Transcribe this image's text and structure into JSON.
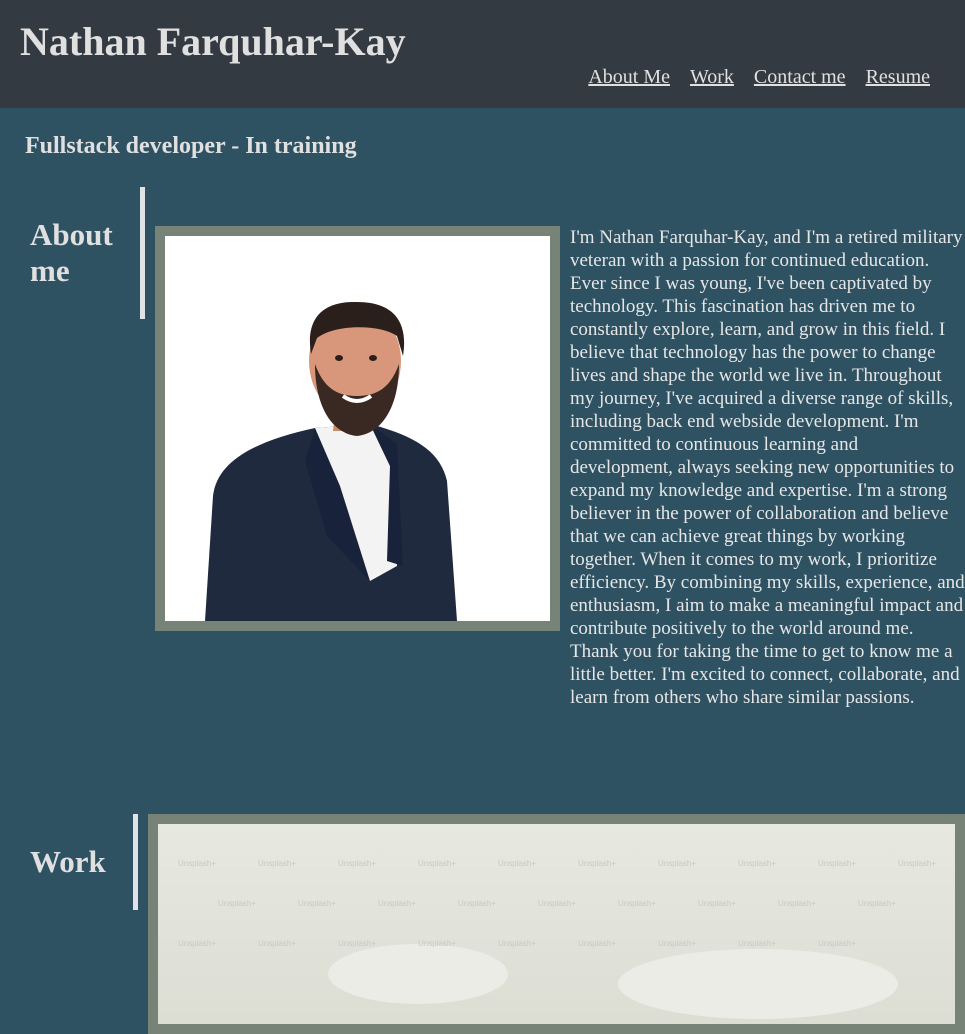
{
  "header": {
    "site_title": "Nathan Farquhar-Kay",
    "nav": [
      {
        "label": "About Me"
      },
      {
        "label": "Work"
      },
      {
        "label": "Contact me"
      },
      {
        "label": "Resume"
      }
    ]
  },
  "tagline": "Fullstack developer - In training",
  "about": {
    "heading": "About me",
    "photo_alt": "Portrait of Nathan Farquhar-Kay",
    "text": "I'm Nathan Farquhar-Kay, and I'm a retired military veteran with a passion for continued education. Ever since I was young, I've been captivated by technology. This fascination has driven me to constantly explore, learn, and grow in this field. I believe that technology has the power to change lives and shape the world we live in. Throughout my journey, I've acquired a diverse range of skills, including back end webside development. I'm committed to continuous learning and development, always seeking new opportunities to expand my knowledge and expertise. I'm a strong believer in the power of collaboration and believe that we can achieve great things by working together. When it comes to my work, I prioritize efficiency. By combining my skills, experience, and enthusiasm, I aim to make a meaningful impact and contribute positively to the world around me. Thank you for taking the time to get to know me a little better. I'm excited to connect, collaborate, and learn from others who share similar passions."
  },
  "work": {
    "heading": "Work",
    "watermark": "Unsplash+"
  },
  "colors": {
    "header_bg": "#333a41",
    "page_bg": "#2f5263",
    "frame": "#778377",
    "text": "#e0e0e0"
  }
}
